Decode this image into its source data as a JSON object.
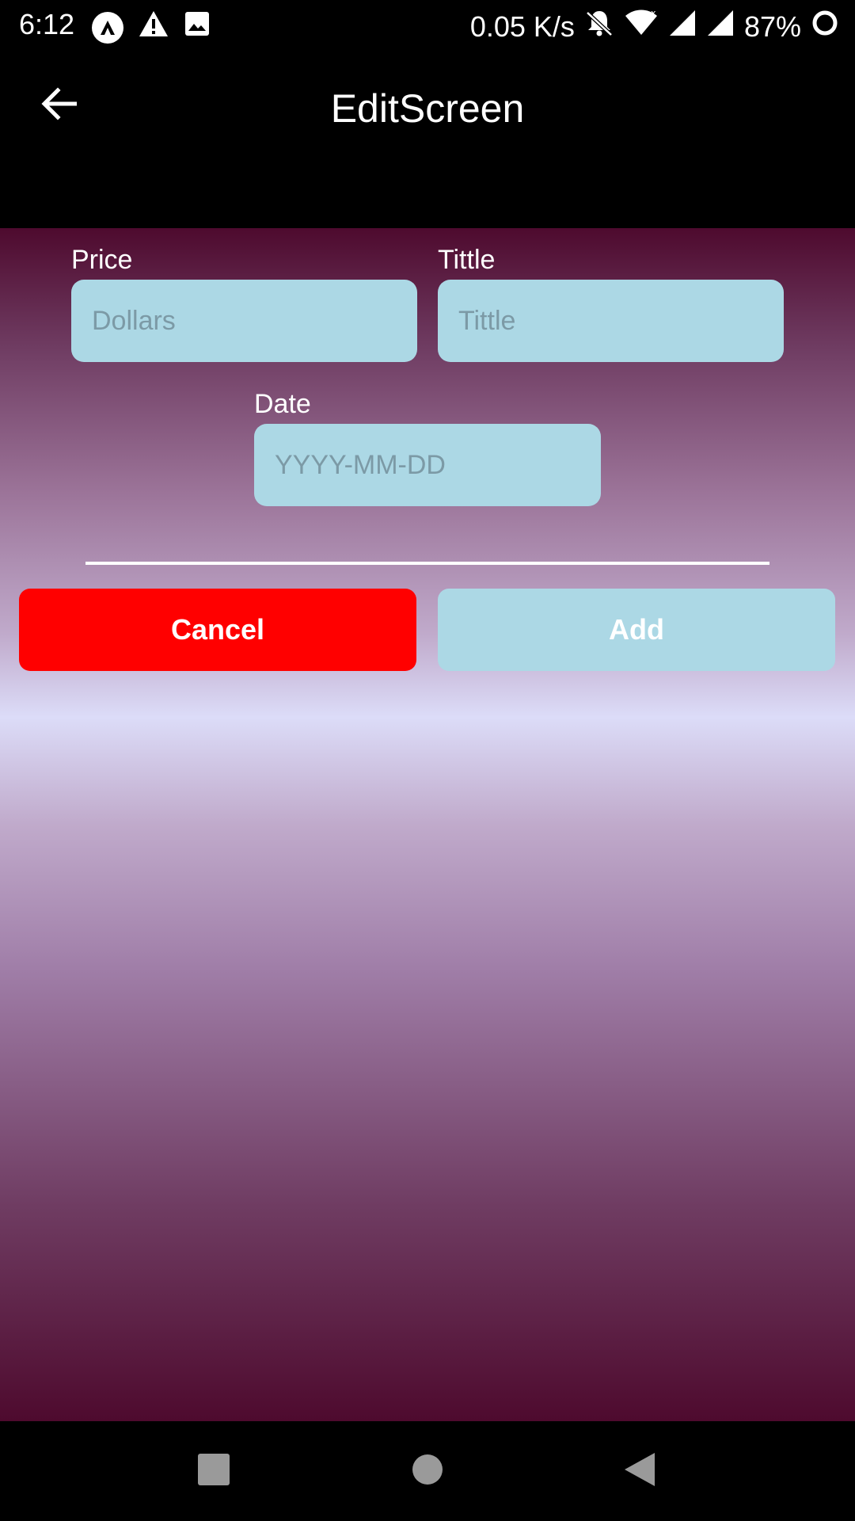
{
  "status_bar": {
    "time": "6:12",
    "network_speed": "0.05 K/s",
    "battery": "87%",
    "icons": [
      "app-a-icon",
      "warning-icon",
      "image-icon",
      "bell-off-icon",
      "wifi-icon",
      "signal-icon",
      "signal-icon",
      "battery-ring-icon"
    ]
  },
  "app_bar": {
    "title": "EditScreen",
    "back_icon": "arrow-left-icon"
  },
  "form": {
    "price": {
      "label": "Price",
      "placeholder": "Dollars",
      "value": ""
    },
    "title": {
      "label": "Tittle",
      "placeholder": "Tittle",
      "value": ""
    },
    "date": {
      "label": "Date",
      "placeholder": "YYYY-MM-DD",
      "value": ""
    }
  },
  "actions": {
    "cancel_label": "Cancel",
    "add_label": "Add"
  },
  "nav_bar": {
    "icons": [
      "recents-square-icon",
      "home-circle-icon",
      "back-triangle-icon"
    ]
  },
  "colors": {
    "input_bg": "#acd8e5",
    "cancel_bg": "#ff0000",
    "add_bg": "#acd8e5",
    "gradient_dark": "#4e0a2e",
    "gradient_light": "#dcdcf8"
  }
}
